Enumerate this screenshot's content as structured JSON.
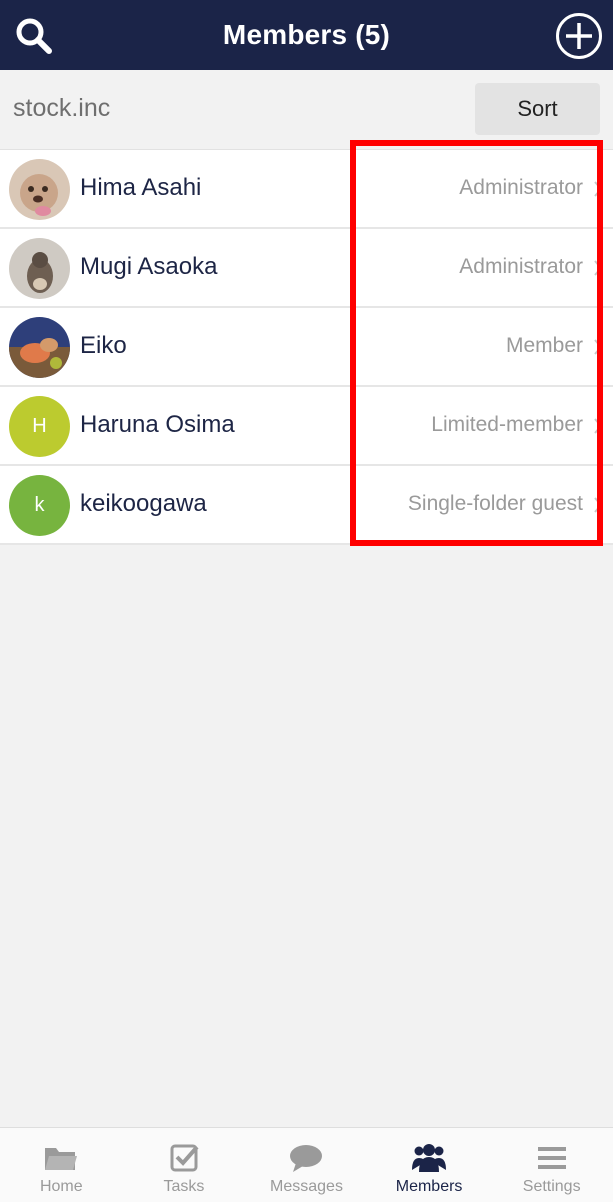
{
  "header": {
    "title": "Members (5)"
  },
  "org": {
    "name": "stock.inc",
    "sort_label": "Sort"
  },
  "members": [
    {
      "name": "Hima Asahi",
      "role": "Administrator",
      "avatar_letter": ""
    },
    {
      "name": "Mugi Asaoka",
      "role": "Administrator",
      "avatar_letter": ""
    },
    {
      "name": "Eiko",
      "role": "Member",
      "avatar_letter": ""
    },
    {
      "name": "Haruna Osima",
      "role": "Limited-member",
      "avatar_letter": "H"
    },
    {
      "name": "keikoogawa",
      "role": "Single-folder guest",
      "avatar_letter": "k"
    }
  ],
  "tabs": [
    {
      "label": "Home",
      "icon": "folder-icon"
    },
    {
      "label": "Tasks",
      "icon": "checkbox-icon"
    },
    {
      "label": "Messages",
      "icon": "chat-bubble-icon"
    },
    {
      "label": "Members",
      "icon": "people-icon",
      "active": true
    },
    {
      "label": "Settings",
      "icon": "hamburger-menu-icon"
    }
  ],
  "colors": {
    "header_bg": "#1b2448",
    "highlight": "#ff0000",
    "avatar_h": "#bccb2f",
    "avatar_k": "#77b43f"
  }
}
